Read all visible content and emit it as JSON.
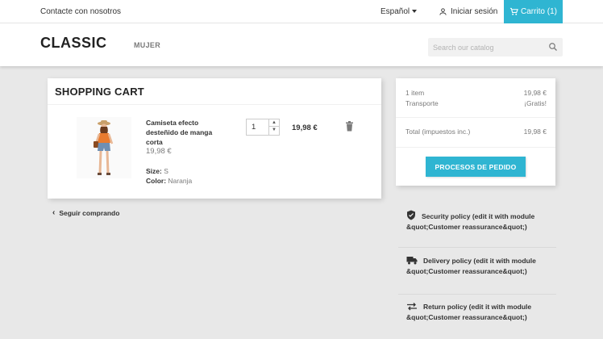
{
  "topbar": {
    "contact": "Contacte con nosotros",
    "language": "Español",
    "signin": "Iniciar sesión",
    "cart": "Carrito (1)"
  },
  "header": {
    "logo": "CLASSIC",
    "menu_item": "MUJER",
    "search_placeholder": "Search our catalog"
  },
  "cart": {
    "title": "SHOPPING CART",
    "product": {
      "name": "Camiseta efecto desteñido de manga corta",
      "price": "19,98 €",
      "size_label": "Size:",
      "size": "S",
      "color_label": "Color:",
      "color": "Naranja",
      "quantity": "1",
      "line_total": "19,98 €"
    },
    "continue": "Seguir comprando"
  },
  "summary": {
    "items_label": "1 item",
    "items_value": "19,98 €",
    "shipping_label": "Transporte",
    "shipping_value": "¡Gratis!",
    "total_label": "Total (impuestos inc.)",
    "total_value": "19,98 €",
    "checkout": "PROCESOS DE PEDIDO"
  },
  "reassurance": [
    {
      "icon": "shield-icon",
      "text": "Security policy (edit it with module &quot;Customer reassurance&quot;)"
    },
    {
      "icon": "truck-icon",
      "text": "Delivery policy (edit it with module &quot;Customer reassurance&quot;)"
    },
    {
      "icon": "swap-arrows-icon",
      "text": "Return policy (edit it with module &quot;Customer reassurance&quot;)"
    }
  ],
  "colors": {
    "accent": "#2fb5d2",
    "background": "#e8e8e8"
  }
}
